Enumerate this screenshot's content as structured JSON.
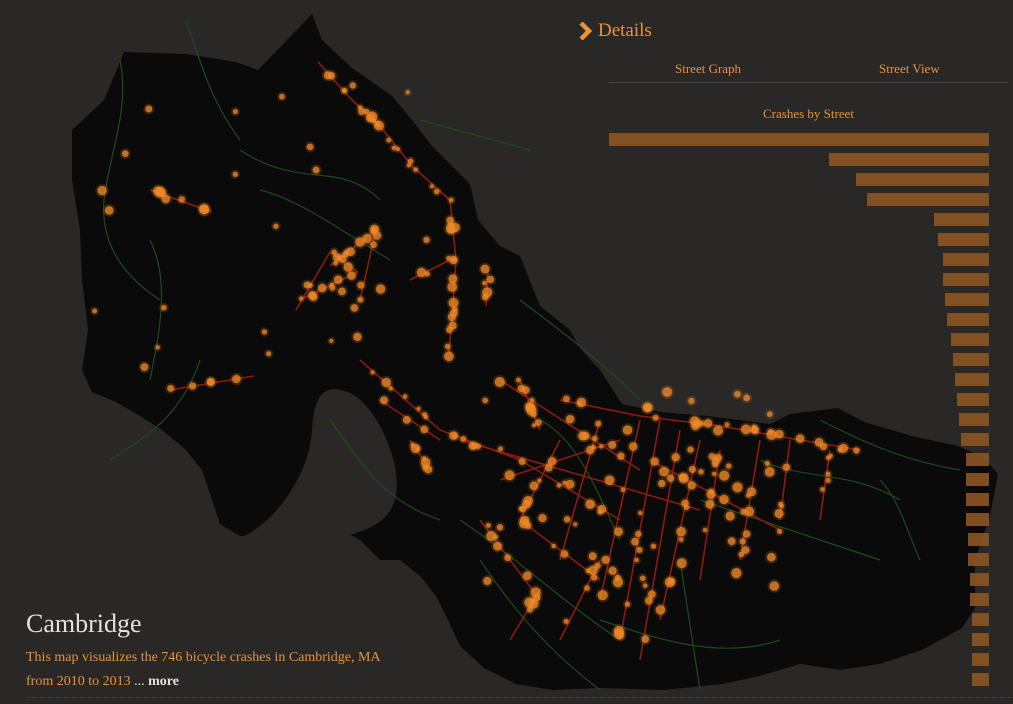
{
  "details": {
    "title": "Details",
    "tabs": [
      "Street Graph",
      "Street View"
    ],
    "chart_title": "Crashes by Street"
  },
  "info": {
    "city": "Cambridge",
    "description": "This map visualizes the 746 bicycle crashes in Cambridge, MA",
    "description_line2": "from 2010 to 2013",
    "ellipsis": "...",
    "more_label": "more"
  },
  "colors": {
    "background": "#2a2827",
    "land": "#0b0a0a",
    "accent": "#e8923a",
    "bar": "#8a5523",
    "street": "#8c1a10",
    "path": "#1d4a1d",
    "crash": "#f08a28"
  },
  "chart_data": {
    "type": "bar",
    "title": "Crashes by Street",
    "orientation": "horizontal",
    "values": [
      100,
      42,
      35,
      32,
      14.5,
      13.5,
      12,
      12,
      11.5,
      11,
      10,
      9.5,
      9,
      8.5,
      8,
      7.5,
      6,
      6,
      6,
      6,
      5.5,
      5.5,
      5,
      5,
      4.5,
      4.5,
      4.5,
      4.5
    ]
  }
}
